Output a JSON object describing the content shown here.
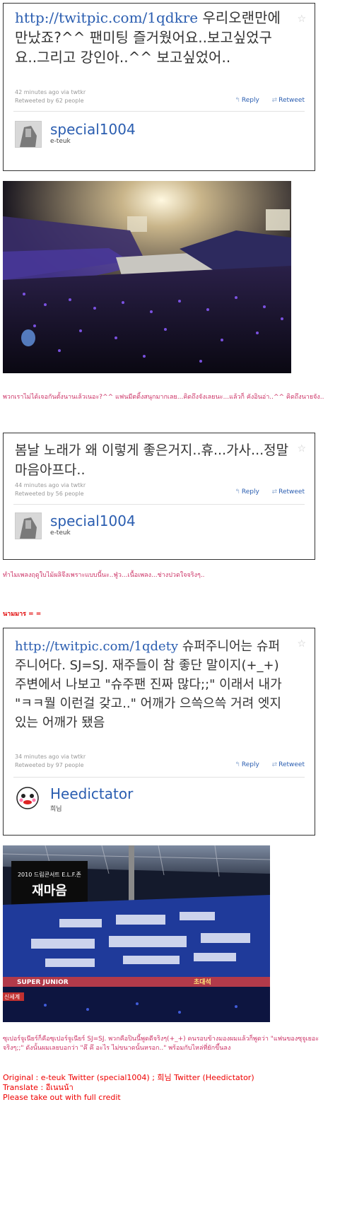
{
  "tweets": [
    {
      "link": "http://twitpic.com/1qdkre",
      "body": " 우리오랜만에 만났죠?^^ 팬미팅 즐거웠어요..보고싶었구요..그리고 강인아..^^ 보고싶었어..",
      "time": "42 minutes ago via twtkr",
      "retweeted": "Retweeted by 62 people",
      "reply": "Reply",
      "retweet": "Retweet",
      "username": "special1004",
      "fullname": "e-teuk"
    },
    {
      "link": "",
      "body": "봄날 노래가 왜 이렇게 좋은거지..휴...가사...정말 마음아프다..",
      "time": "44 minutes ago via twtkr",
      "retweeted": "Retweeted by 56 people",
      "reply": "Reply",
      "retweet": "Retweet",
      "username": "special1004",
      "fullname": "e-teuk"
    },
    {
      "link": "http://twitpic.com/1qdety",
      "body": " 슈퍼주니어는 슈퍼주니어다. SJ=SJ. 재주들이 참 좋단 말이지(+_+) 주변에서 나보고 \"슈주팬 진짜 많다;;\" 이래서 내가 \"ㅋㅋ뭘 이런걸 갖고..\" 어깨가 으쓱으쓱 거려 엣지있는 어깨가 됐음",
      "time": "34 minutes ago via twtkr",
      "retweeted": "Retweeted by 97 people",
      "reply": "Reply",
      "retweet": "Retweet",
      "username": "Heedictator",
      "fullname": "희님"
    }
  ],
  "translations": {
    "t1": "พวกเราไม่ได้เจอกันตั้งนานเล้วเนอะ?^^ แฟนมีตติ้งสนุกมากเลย...คิดถึงจังเลยนะ...แล้วก็ คังอินอ่า..^^ คิดถึงนายจัง..",
    "t2": "ทำไมเพลงฤดูใบไม้ผลิจึงเพราะแบบนี้นะ..ฟู่ว...เนื้อเพลง...ช่างปวดใจจริงๆ..",
    "note": "นามมาร = =",
    "t3": "ซุเปอร์จูเนียร์ก็คือซุเปอร์จูเนียร์ SJ=SJ. พวกคือปินนี้พูดดีจริงๆ(+_+) คนรอบข้างมองผมแล้วก็พูดว่า \"แฟนของซุจูเยอะจริงๆ;;\" ดังนั้นผมเลยบอกว่า \"คึ คึ อะไร ไม่ขนาดนั้นหรอก..\" พร้อมกับไหล่ที่ยักขึ้นลง"
  },
  "photo2": {
    "banner_small": "2010 드림콘서트 E.L.F.존",
    "banner_big": "재마음",
    "ad1": "SUPER JUNIOR",
    "ad2": "신세계",
    "ad3": "초대석"
  },
  "credits": {
    "original": "Original : e-teuk Twitter (special1004) ; 희님 Twitter (Heedictator)",
    "translate": "Translate : อีเนนน้า",
    "notice": "Please take out with full credit"
  },
  "colors": {
    "link": "#2a5db0",
    "thai": "#cc3366",
    "credit": "#ee0000"
  },
  "icons": {
    "favorite": "star-icon",
    "reply": "reply-arrow-icon",
    "retweet": "retweet-icon"
  }
}
